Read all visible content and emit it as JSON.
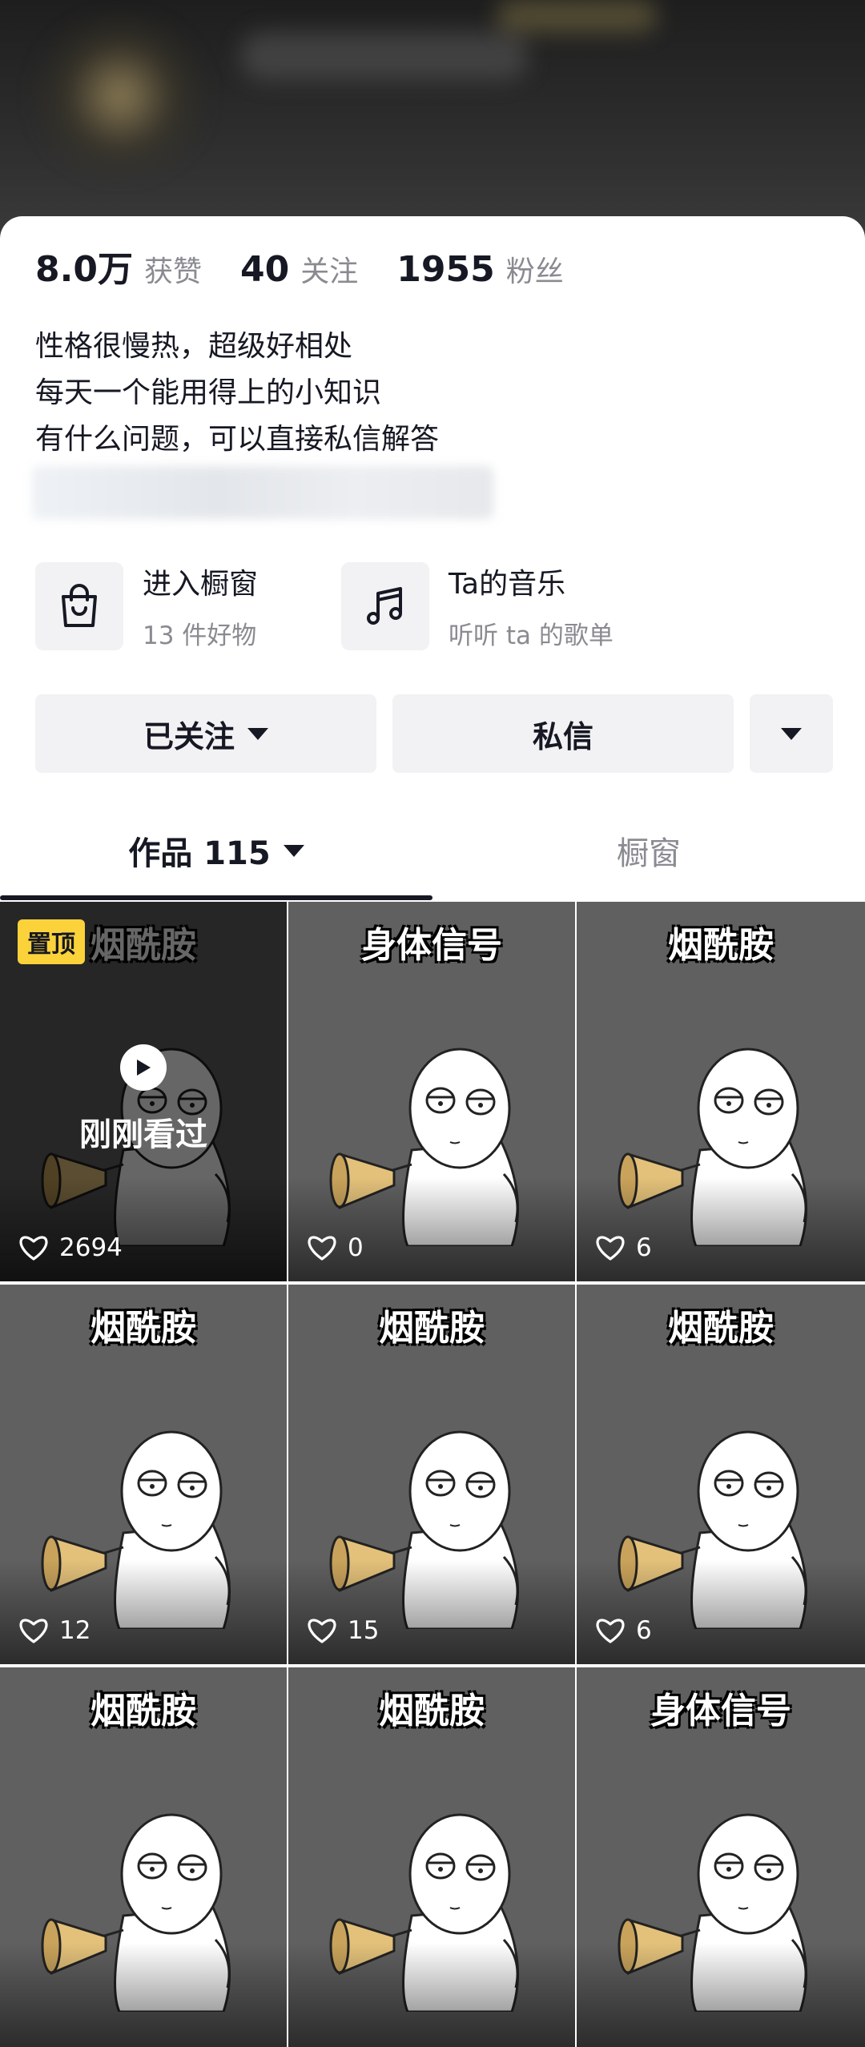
{
  "stats": [
    {
      "num": "8.0万",
      "label": "获赞"
    },
    {
      "num": "40",
      "label": "关注"
    },
    {
      "num": "1955",
      "label": "粉丝"
    }
  ],
  "bio": [
    "性格很慢热，超级好相处",
    "每天一个能用得上的小知识",
    "有什么问题，可以直接私信解答"
  ],
  "features": [
    {
      "title": "进入橱窗",
      "subtitle": "13 件好物",
      "icon": "shopping-bag-icon"
    },
    {
      "title": "Ta的音乐",
      "subtitle": "听听 ta 的歌单",
      "icon": "music-note-icon"
    }
  ],
  "actions": {
    "follow_label": "已关注",
    "message_label": "私信",
    "more_icon": "caret-down-icon"
  },
  "tabs": {
    "works_label": "作品 115",
    "shop_label": "橱窗"
  },
  "videos": [
    {
      "title": "烟酰胺",
      "likes": "2694",
      "pinned_label": "置顶",
      "watched_label": "刚刚看过"
    },
    {
      "title": "身体信号",
      "likes": "0"
    },
    {
      "title": "烟酰胺",
      "likes": "6"
    },
    {
      "title": "烟酰胺",
      "likes": "12"
    },
    {
      "title": "烟酰胺",
      "likes": "15"
    },
    {
      "title": "烟酰胺",
      "likes": "6"
    },
    {
      "title": "烟酰胺"
    },
    {
      "title": "烟酰胺"
    },
    {
      "title": "身体信号"
    }
  ],
  "colors": {
    "pinned_badge": "#fbd23a",
    "tile_bg": "#606060",
    "text_primary": "#161823",
    "text_secondary": "#8a8b91"
  }
}
